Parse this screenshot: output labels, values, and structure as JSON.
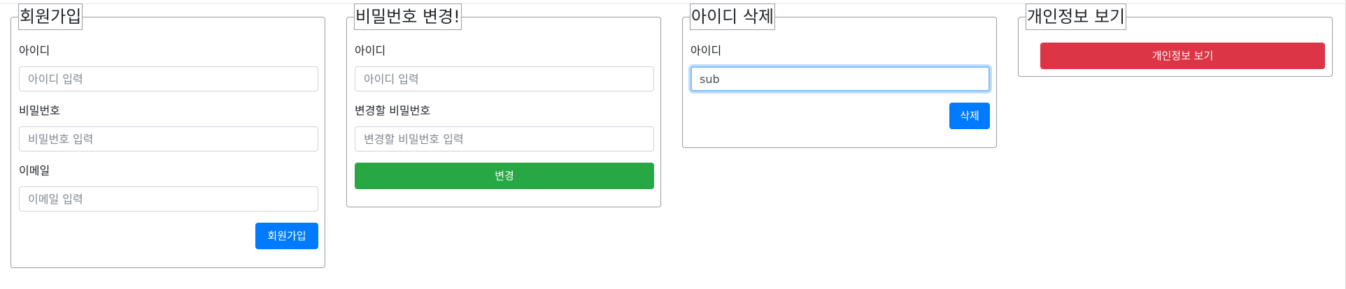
{
  "signup": {
    "legend": "회원가입",
    "id_label": "아이디",
    "id_placeholder": "아이디 입력",
    "pw_label": "비밀번호",
    "pw_placeholder": "비밀번호 입력",
    "email_label": "이메일",
    "email_placeholder": "이메일 입력",
    "submit_label": "회원가입",
    "submit_color": "#007bff"
  },
  "change_password": {
    "legend": "비밀번호 변경!",
    "id_label": "아이디",
    "id_placeholder": "아이디 입력",
    "new_pw_label": "변경할 비밀번호",
    "new_pw_placeholder": "변경할 비밀번호 입력",
    "submit_label": "변경",
    "submit_color": "#28a745"
  },
  "delete_id": {
    "legend": "아이디 삭제",
    "id_label": "아이디",
    "id_value": "sub",
    "submit_label": "삭제",
    "submit_color": "#007bff"
  },
  "view_info": {
    "legend": "개인정보 보기",
    "button_label": "개인정보 보기",
    "button_color": "#dc3545"
  }
}
